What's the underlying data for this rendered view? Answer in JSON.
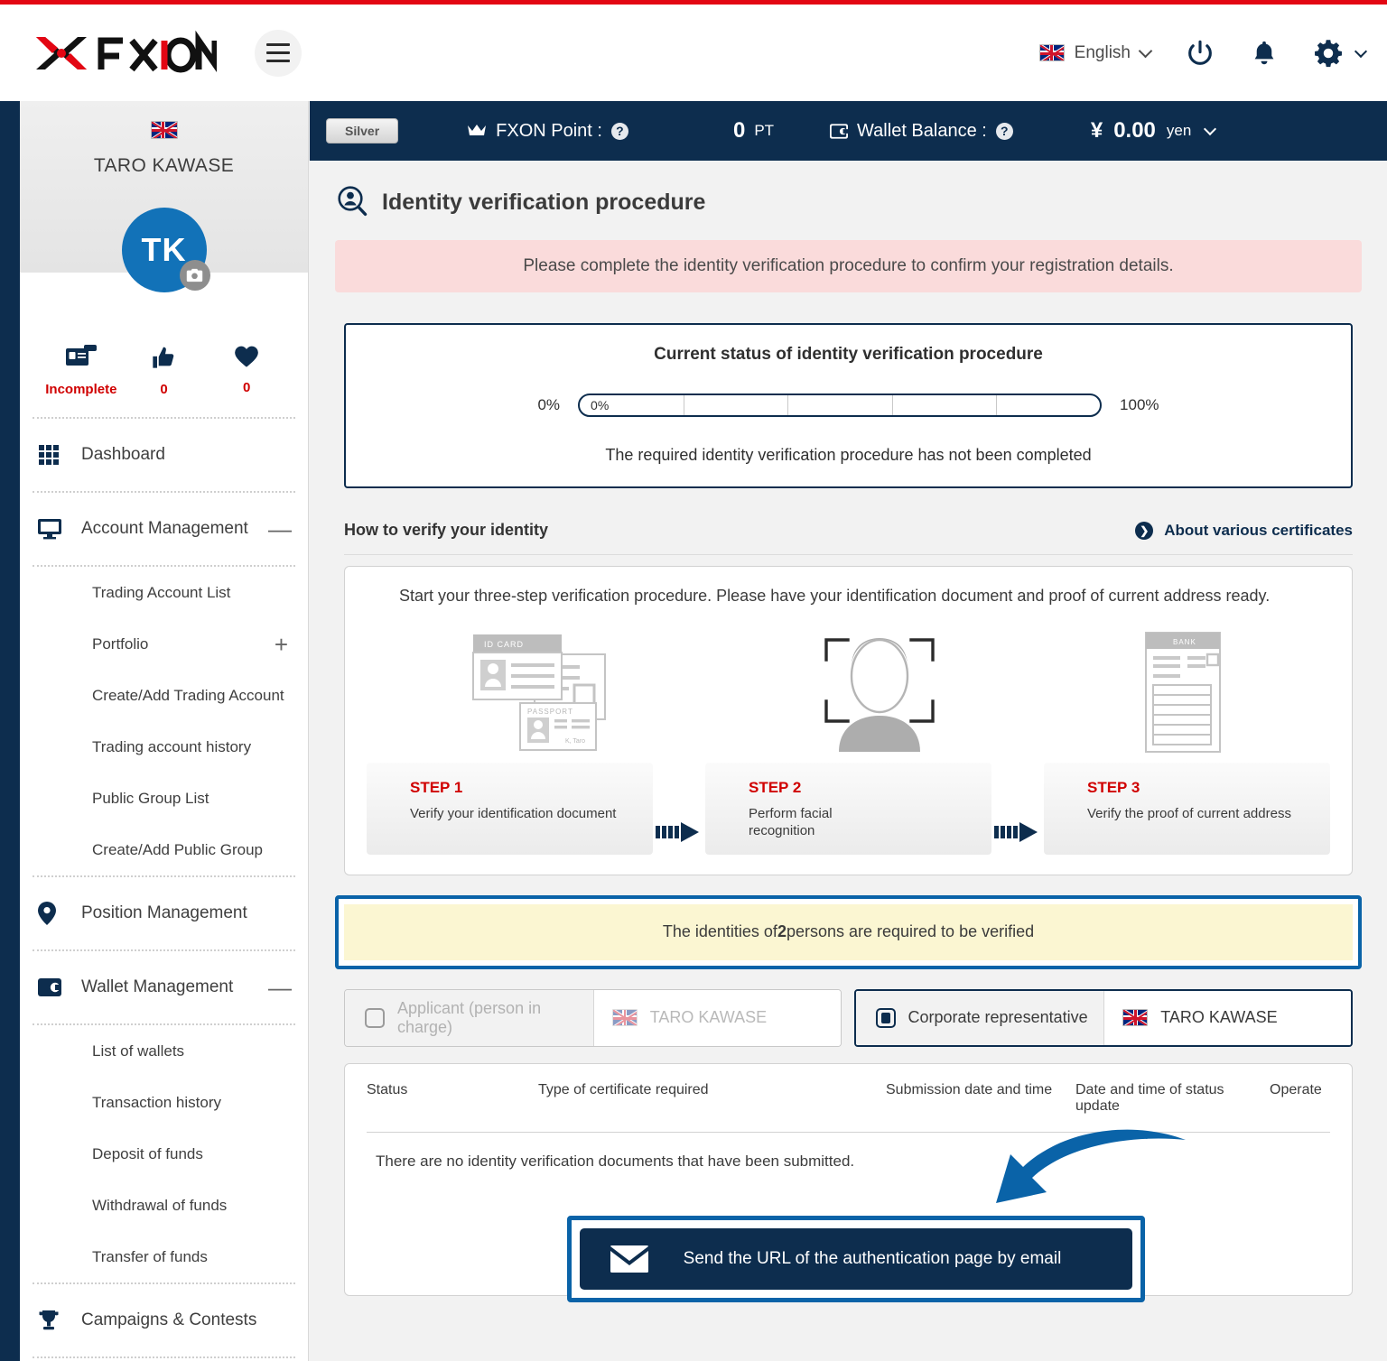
{
  "brand": {
    "name": "FXON",
    "accent_red": "#e30613",
    "navy": "#0d2d4e",
    "blue_highlight": "#0a63a8"
  },
  "header": {
    "language": {
      "label": "English",
      "flag": "uk-flag-icon"
    },
    "icons": [
      {
        "name": "power-icon"
      },
      {
        "name": "bell-icon"
      },
      {
        "name": "gear-icon"
      }
    ],
    "menu_icon": "hamburger-menu-icon"
  },
  "account_bar": {
    "rank_badge": "Silver",
    "point_label": "FXON Point :",
    "point_value": "0",
    "point_unit": "PT",
    "wallet_label": "Wallet Balance :",
    "wallet_symbol": "¥",
    "wallet_value": "0.00",
    "wallet_unit": "yen"
  },
  "sidebar": {
    "user_name": "TARO KAWASE",
    "avatar_initials": "TK",
    "stats": [
      {
        "icon": "id-card-icon",
        "label": "Incomplete"
      },
      {
        "icon": "thumbs-up-icon",
        "label": "0"
      },
      {
        "icon": "heart-icon",
        "label": "0"
      }
    ],
    "nav": [
      {
        "icon": "grid-icon",
        "label": "Dashboard",
        "expand": ""
      },
      {
        "icon": "monitor-icon",
        "label": "Account Management",
        "expand": "—"
      },
      {
        "icon": "location-pin-icon",
        "label": "Position Management",
        "expand": ""
      },
      {
        "icon": "wallet-icon",
        "label": "Wallet Management",
        "expand": "—"
      },
      {
        "icon": "trophy-icon",
        "label": "Campaigns & Contests",
        "expand": ""
      }
    ],
    "account_sub": [
      {
        "label": "Trading Account List",
        "plus": ""
      },
      {
        "label": "Portfolio",
        "plus": "+"
      },
      {
        "label": "Create/Add Trading Account",
        "plus": ""
      },
      {
        "label": "Trading account history",
        "plus": ""
      },
      {
        "label": "Public Group List",
        "plus": ""
      },
      {
        "label": "Create/Add Public Group",
        "plus": ""
      }
    ],
    "wallet_sub": [
      {
        "label": "List of wallets"
      },
      {
        "label": "Transaction history"
      },
      {
        "label": "Deposit of funds"
      },
      {
        "label": "Withdrawal of funds"
      },
      {
        "label": "Transfer of funds"
      }
    ]
  },
  "main": {
    "page_title": "Identity verification procedure",
    "alert": "Please complete the identity verification procedure to confirm your registration details.",
    "status_card": {
      "title": "Current status of identity verification procedure",
      "min_label": "0%",
      "max_label": "100%",
      "current_label": "0%",
      "progress_percent": 0,
      "note": "The required identity verification procedure has not been completed"
    },
    "howto": {
      "title": "How to verify your identity",
      "certificates_link": "About various certificates"
    },
    "steps_card": {
      "lead": "Start your three-step verification procedure. Please have your identification document and proof of current address ready.",
      "steps": [
        {
          "icon": "id-documents-icon",
          "heading": "STEP 1",
          "desc": "Verify your identification document",
          "card_labels": {
            "id": "ID CARD",
            "passport": "PASSPORT",
            "passport_name": "K, Taro"
          }
        },
        {
          "icon": "facial-recognition-icon",
          "heading": "STEP 2",
          "desc": "Perform facial recognition"
        },
        {
          "icon": "bank-statement-icon",
          "heading": "STEP 3",
          "desc": "Verify the proof of current address",
          "card_labels": {
            "bank": "BANK"
          }
        }
      ]
    },
    "yellow_notice": {
      "prefix": "The identities of ",
      "count": "2",
      "suffix": " persons are required to be verified"
    },
    "person_tabs": [
      {
        "role": "Applicant (person in charge)",
        "name": "TARO KAWASE",
        "selected": false,
        "disabled": true
      },
      {
        "role": "Corporate representative",
        "name": "TARO KAWASE",
        "selected": true,
        "disabled": false
      }
    ],
    "table": {
      "headers": [
        "Status",
        "Type of certificate required",
        "Submission date and time",
        "Date and time of status update",
        "Operate"
      ],
      "empty_message": "There are no identity verification documents that have been submitted."
    },
    "send_button": {
      "icon": "envelope-icon",
      "label": "Send the URL of the authentication page by email"
    }
  }
}
